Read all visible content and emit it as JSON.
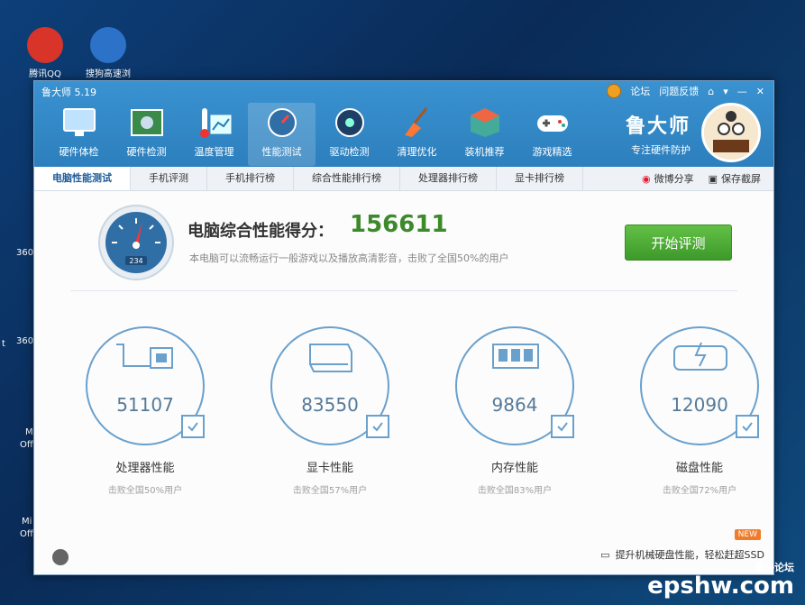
{
  "desktop": {
    "icons": [
      {
        "label": "腾讯QQ"
      },
      {
        "label": "搜狗高速浏"
      }
    ],
    "left_edge_labels": [
      "360",
      "360",
      "t",
      "Mi",
      "Offi",
      "Mi",
      "Offi"
    ]
  },
  "window": {
    "title": "鲁大师 5.19",
    "links": {
      "forum": "论坛",
      "feedback": "问题反馈"
    },
    "brand": {
      "name": "鲁大师",
      "slogan": "专注硬件防护"
    },
    "toolbar": [
      {
        "label": "硬件体检",
        "icon": "monitor-icon"
      },
      {
        "label": "硬件检测",
        "icon": "board-icon"
      },
      {
        "label": "温度管理",
        "icon": "thermometer-icon"
      },
      {
        "label": "性能测试",
        "icon": "gauge-icon",
        "active": true
      },
      {
        "label": "驱动检测",
        "icon": "drive-icon"
      },
      {
        "label": "清理优化",
        "icon": "broom-icon"
      },
      {
        "label": "装机推荐",
        "icon": "cube-icon"
      },
      {
        "label": "游戏精选",
        "icon": "gamepad-icon"
      }
    ],
    "subtabs": [
      {
        "label": "电脑性能测试",
        "active": true
      },
      {
        "label": "手机评测"
      },
      {
        "label": "手机排行榜"
      },
      {
        "label": "综合性能排行榜"
      },
      {
        "label": "处理器排行榜"
      },
      {
        "label": "显卡排行榜"
      }
    ],
    "sub_actions": {
      "share": "微博分享",
      "screenshot": "保存截屏"
    }
  },
  "score": {
    "title": "电脑综合性能得分：",
    "value": "156611",
    "description": "本电脑可以流畅运行一般游戏以及播放高清影音，击败了全国50%的用户",
    "gauge_reading": "234",
    "start_button": "开始评测"
  },
  "metrics": [
    {
      "label": "处理器性能",
      "value": "51107",
      "desc": "击败全国50%用户",
      "icon": "cpu-monitor-icon"
    },
    {
      "label": "显卡性能",
      "value": "83550",
      "desc": "击败全国57%用户",
      "icon": "graphics-card-icon"
    },
    {
      "label": "内存性能",
      "value": "9864",
      "desc": "击败全国83%用户",
      "icon": "memory-chip-icon"
    },
    {
      "label": "磁盘性能",
      "value": "12090",
      "desc": "击败全国72%用户",
      "icon": "disk-icon"
    }
  ],
  "promo": {
    "text": "提升机械硬盘性能，轻松赶超SSD",
    "badge": "NEW"
  },
  "watermark": {
    "text": "epshw.com",
    "sub": "恩平论坛"
  },
  "colors": {
    "header": "#2d7fbd",
    "score": "#3c8a2a",
    "button": "#4caf34",
    "ring": "#6aa0cc"
  }
}
